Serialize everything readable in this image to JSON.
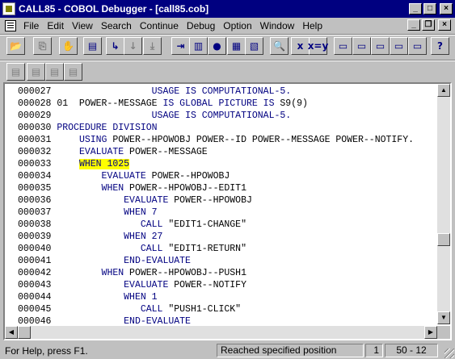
{
  "window": {
    "title": "CALL85 - COBOL Debugger - [call85.cob]",
    "minimize_glyph": "_",
    "maximize_glyph": "□",
    "close_glyph": "×",
    "doc_minimize_glyph": "_",
    "doc_restore_glyph": "❐",
    "doc_close_glyph": "×"
  },
  "menu": [
    "File",
    "Edit",
    "View",
    "Search",
    "Continue",
    "Debug",
    "Option",
    "Window",
    "Help"
  ],
  "toolbar1": [
    {
      "name": "open-button",
      "glyph": "📂"
    },
    {
      "name": "copy-button",
      "glyph": "⎘"
    },
    {
      "name": "hand-button",
      "glyph": "✋"
    },
    {
      "name": "view-source-button",
      "glyph": "▤"
    },
    {
      "name": "step-into-button",
      "glyph": "↳"
    },
    {
      "name": "step-over-button",
      "glyph": "↓"
    },
    {
      "name": "step-down-button",
      "glyph": "⤓"
    },
    {
      "name": "run-to-button",
      "glyph": "⇥"
    },
    {
      "name": "animate-button",
      "glyph": "▥"
    },
    {
      "name": "breakpoint-button",
      "glyph": "●"
    },
    {
      "name": "watch-button",
      "glyph": "▦"
    },
    {
      "name": "modules-button",
      "glyph": "▧"
    },
    {
      "name": "find-button",
      "glyph": "🔍"
    },
    {
      "name": "examine-x-button",
      "glyph": "x"
    },
    {
      "name": "examine-xy-button",
      "glyph": "x=y"
    },
    {
      "name": "window1-button",
      "glyph": "▭"
    },
    {
      "name": "window2-button",
      "glyph": "▭"
    },
    {
      "name": "window3-button",
      "glyph": "▭"
    },
    {
      "name": "window4-button",
      "glyph": "▭"
    },
    {
      "name": "window5-button",
      "glyph": "▭"
    },
    {
      "name": "context-help-button",
      "glyph": "?"
    }
  ],
  "toolbar2": [
    {
      "name": "tool2-a-button",
      "glyph": "▤"
    },
    {
      "name": "tool2-b-button",
      "glyph": "▤"
    },
    {
      "name": "tool2-c-button",
      "glyph": "▤"
    },
    {
      "name": "tool2-d-button",
      "glyph": "▤"
    }
  ],
  "code_lines": [
    {
      "num": "000027",
      "pre": "                  ",
      "kw": "USAGE IS COMPUTATIONAL-5.",
      "post": "",
      "hl": false
    },
    {
      "num": "000028",
      "pre": " 01  POWER--MESSAGE ",
      "kw": "IS GLOBAL PICTURE IS",
      "post": " S9(9)",
      "hl": false
    },
    {
      "num": "000029",
      "pre": "                  ",
      "kw": "USAGE IS COMPUTATIONAL-5.",
      "post": "",
      "hl": false
    },
    {
      "num": "000030",
      "pre": " ",
      "kw": "PROCEDURE DIVISION",
      "post": "",
      "hl": false
    },
    {
      "num": "000031",
      "pre": "     ",
      "kw": "USING",
      "post": " POWER--HPOWOBJ POWER--ID POWER--MESSAGE POWER--NOTIFY.",
      "hl": false
    },
    {
      "num": "000032",
      "pre": "     ",
      "kw": "EVALUATE",
      "post": " POWER--MESSAGE",
      "hl": false
    },
    {
      "num": "000033",
      "pre": "     ",
      "kw": "WHEN 1025",
      "post": "",
      "hl": true
    },
    {
      "num": "000034",
      "pre": "         ",
      "kw": "EVALUATE",
      "post": " POWER--HPOWOBJ",
      "hl": false
    },
    {
      "num": "000035",
      "pre": "         ",
      "kw": "WHEN",
      "post": " POWER--HPOWOBJ--EDIT1",
      "hl": false
    },
    {
      "num": "000036",
      "pre": "             ",
      "kw": "EVALUATE",
      "post": " POWER--HPOWOBJ",
      "hl": false
    },
    {
      "num": "000037",
      "pre": "             ",
      "kw": "WHEN 7",
      "post": "",
      "hl": false
    },
    {
      "num": "000038",
      "pre": "                ",
      "kw": "CALL",
      "post": " \"EDIT1-CHANGE\"",
      "hl": false
    },
    {
      "num": "000039",
      "pre": "             ",
      "kw": "WHEN 27",
      "post": "",
      "hl": false
    },
    {
      "num": "000040",
      "pre": "                ",
      "kw": "CALL",
      "post": " \"EDIT1-RETURN\"",
      "hl": false
    },
    {
      "num": "000041",
      "pre": "             ",
      "kw": "END-EVALUATE",
      "post": "",
      "hl": false
    },
    {
      "num": "000042",
      "pre": "         ",
      "kw": "WHEN",
      "post": " POWER--HPOWOBJ--PUSH1",
      "hl": false
    },
    {
      "num": "000043",
      "pre": "             ",
      "kw": "EVALUATE",
      "post": " POWER--NOTIFY",
      "hl": false
    },
    {
      "num": "000044",
      "pre": "             ",
      "kw": "WHEN 1",
      "post": "",
      "hl": false
    },
    {
      "num": "000045",
      "pre": "                ",
      "kw": "CALL",
      "post": " \"PUSH1-CLICK\"",
      "hl": false
    },
    {
      "num": "000046",
      "pre": "             ",
      "kw": "END-EVALUATE",
      "post": "",
      "hl": false
    }
  ],
  "colors": {
    "keyword": "#000080",
    "highlight": "#ffff00",
    "title_bar": "#000080"
  },
  "status": {
    "help": "For Help, press F1.",
    "message": "Reached specified position",
    "count": "1",
    "position": "50 - 12"
  }
}
